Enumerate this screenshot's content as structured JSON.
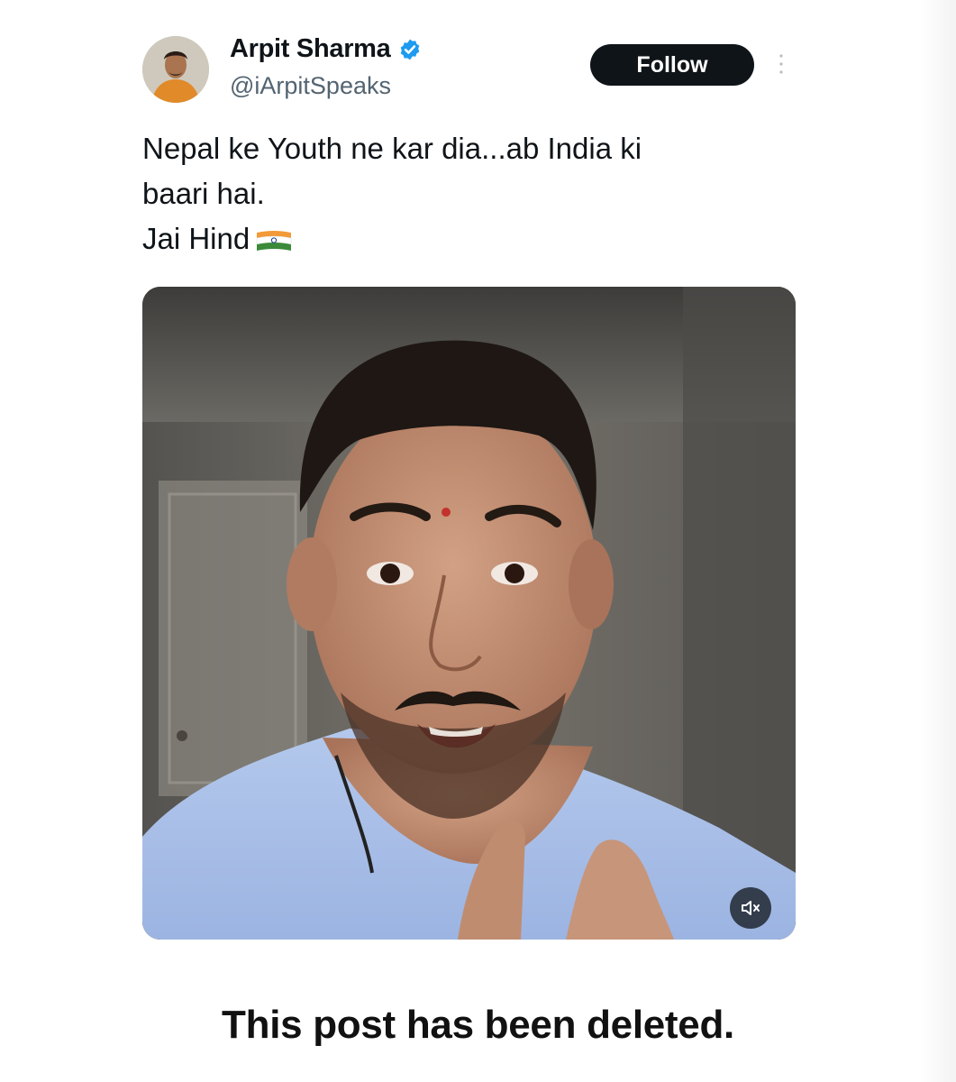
{
  "post": {
    "author": {
      "display_name": "Arpit Sharma",
      "handle": "@iArpitSpeaks",
      "verified": true,
      "avatar_icon": "profile-photo"
    },
    "follow_label": "Follow",
    "more_icon": "more-vertical-icon",
    "text_lines": [
      "Nepal ke Youth ne kar dia...ab India ki",
      "baari hai.",
      "Jai Hind"
    ],
    "emoji": "flag-india-icon",
    "media": {
      "type": "video",
      "mute_icon": "speaker-muted-icon"
    }
  },
  "caption": "This post has been deleted.",
  "colors": {
    "follow_bg": "#0f1419",
    "verified_blue": "#1d9bf0",
    "handle_gray": "#536471"
  }
}
